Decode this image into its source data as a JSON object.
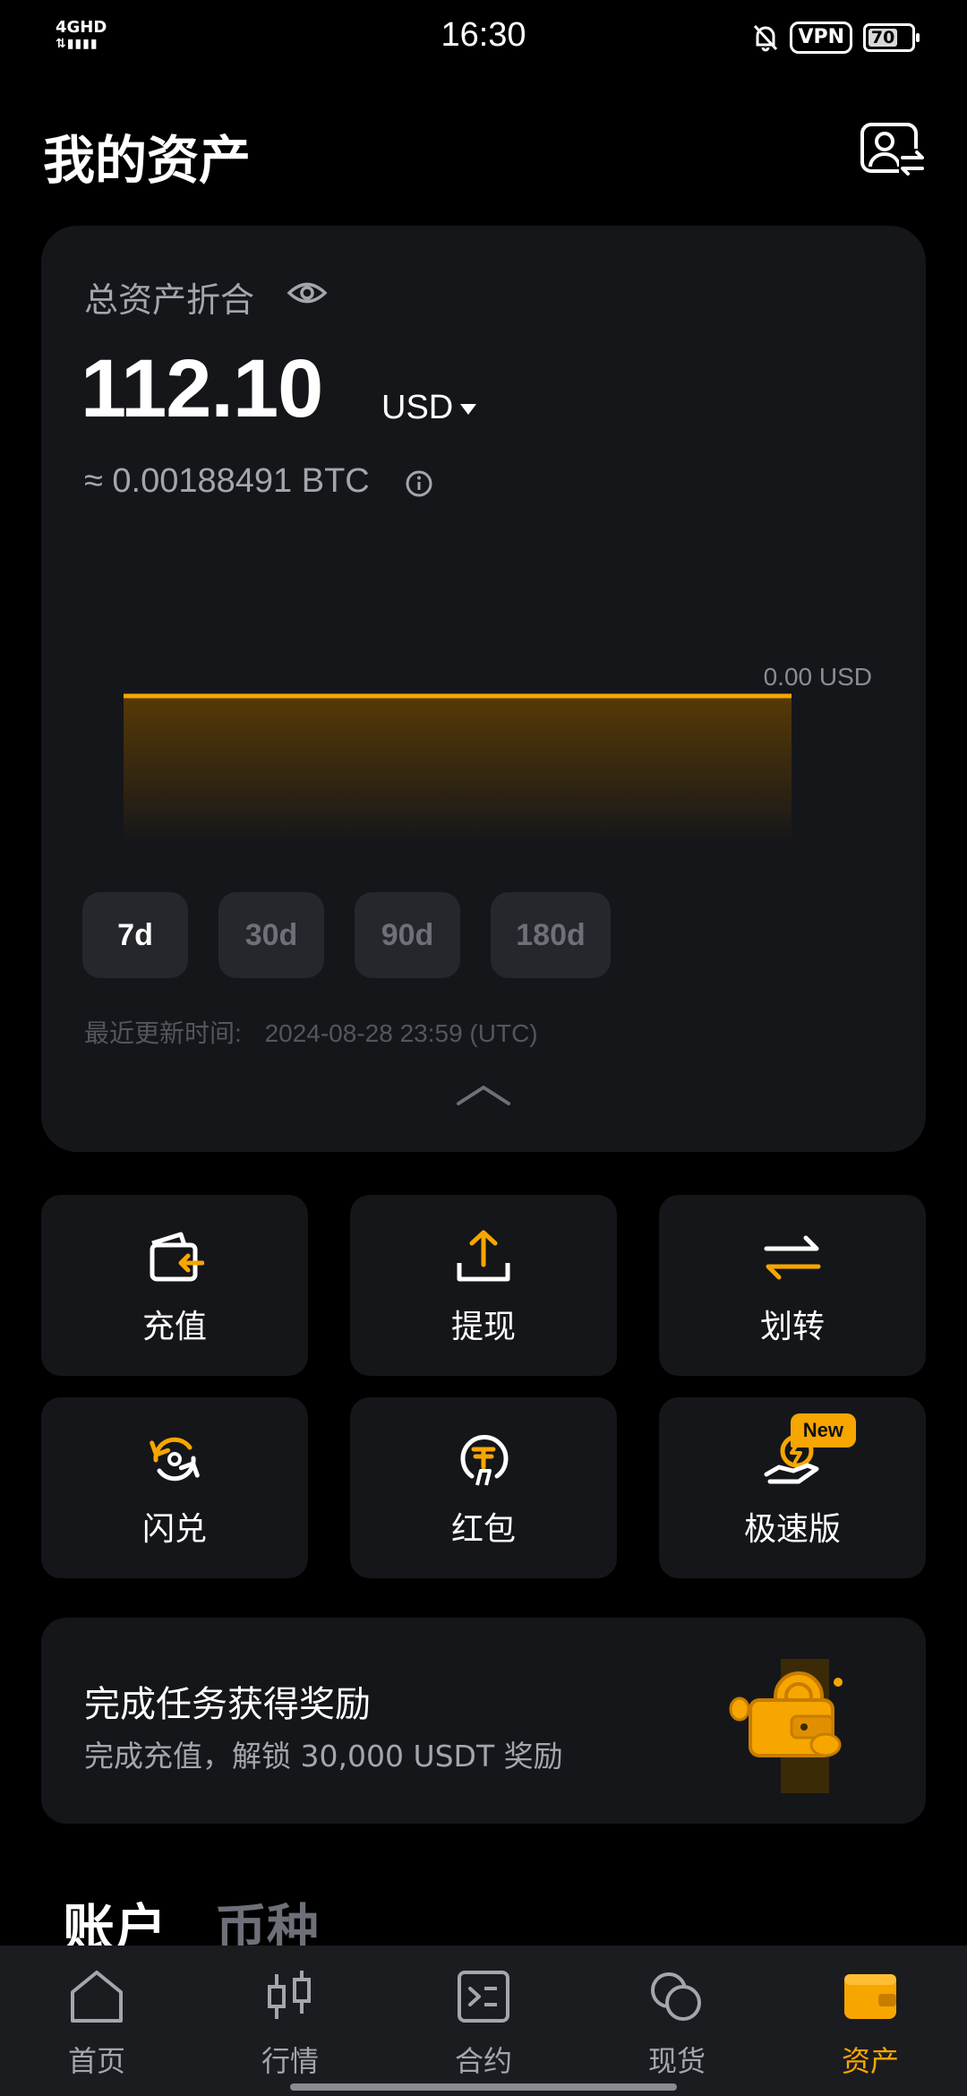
{
  "status_bar": {
    "network": "4GHD",
    "time": "16:30",
    "vpn": "VPN",
    "battery": "70"
  },
  "header": {
    "title": "我的资产",
    "account_switch_icon": "user-switch-icon"
  },
  "overview": {
    "label": "总资产折合",
    "total": "112.10",
    "currency": "USD",
    "btc_equivalent": "≈ 0.00188491 BTC",
    "chart_label": "0.00 USD",
    "ranges": [
      "7d",
      "30d",
      "90d",
      "180d"
    ],
    "selected_range": "7d",
    "updated_label": "最近更新时间:",
    "updated_time": "2024-08-28 23:59 (UTC)",
    "accent_color": "#f7a600"
  },
  "actions": {
    "deposit": "充值",
    "withdraw": "提现",
    "transfer": "划转",
    "convert": "闪兑",
    "red_packet": "红包",
    "lite": "极速版",
    "new_badge": "New"
  },
  "promo": {
    "title": "完成任务获得奖励",
    "subtitle": "完成充值，解锁 30,000 USDT 奖励"
  },
  "section_tabs": {
    "account": "账户",
    "coin": "币种"
  },
  "bottom_nav": {
    "home": "首页",
    "markets": "行情",
    "futures": "合约",
    "spot": "现货",
    "assets": "资产",
    "active": "资产"
  }
}
